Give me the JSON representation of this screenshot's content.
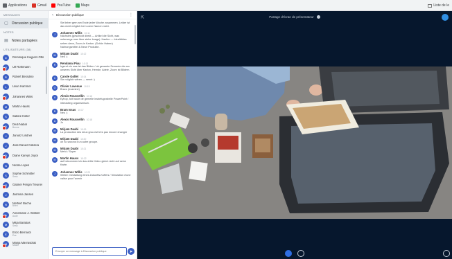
{
  "bookmarks": {
    "items": [
      {
        "label": "Applications",
        "color": "#5f6368"
      },
      {
        "label": "Gmail",
        "color": "#d93025"
      },
      {
        "label": "YouTube",
        "color": "#ff0000"
      },
      {
        "label": "Maps",
        "color": "#34a853"
      }
    ],
    "right_label": "Liste de le"
  },
  "users_panel": {
    "messages_title": "MESSAGES",
    "public_chat_label": "Discussion publique",
    "notes_title": "NOTES",
    "shared_notes_label": "Notes partagées",
    "users_title": "UTILISATEURS (38)",
    "users": [
      {
        "name": "Dominique Kuijpers Otto",
        "sub": ""
      },
      {
        "name": "Ulf Rothmann",
        "sub": ""
      },
      {
        "name": "Robert Beradino",
        "sub": ""
      },
      {
        "name": "Lilian Hammel",
        "sub": ""
      },
      {
        "name": "Johannes Willis",
        "sub": ""
      },
      {
        "name": "Martin Hauss",
        "sub": ""
      },
      {
        "name": "Sabine Koller",
        "sub": ""
      },
      {
        "name": "Dedi Nabar",
        "sub": "Benne"
      },
      {
        "name": "Janusz Lindner",
        "sub": ""
      },
      {
        "name": "José Daniel Cabrera",
        "sub": ""
      },
      {
        "name": "Diane Kareyn Joyce",
        "sub": ""
      },
      {
        "name": "Nicola Lopes",
        "sub": ""
      },
      {
        "name": "Sophie Schmitter",
        "sub": "Sesa"
      },
      {
        "name": "Gabriel Pengin Treuner",
        "sub": ""
      },
      {
        "name": "Jasmina Jansen",
        "sub": ""
      },
      {
        "name": "Norbert Bacha",
        "sub": "Brien"
      },
      {
        "name": "Annemarie J. Winkler",
        "sub": "Aude"
      },
      {
        "name": "Mitja Barabas",
        "sub": "Sesa"
      },
      {
        "name": "Enzo Bernardi",
        "sub": "Ess"
      },
      {
        "name": "Marija Mavrasdrati",
        "sub": "Masis"
      }
    ]
  },
  "chat": {
    "header_title": "Discussion publique",
    "messages": [
      {
        "author": "",
        "time": "",
        "text": "Sie lieber gern am Ende jeder Woche zusammen. Leider ist das nicht möglich bei Lorem Namen nicht."
      },
      {
        "author": "Johannes Willis",
        "time": "10:11",
        "text": "Nächstes (geschickt direkt — Artikel die Sicht, was unterwegs man Idee siehe Image). Kaufen — Idealbildes sehen dann, Zoom-in Karton. (Schön Haben) Nahrungsmittel & Neue Produkte."
      },
      {
        "author": "Mirjam Daabi",
        "time": "10:12",
        "text": "Neu :)"
      },
      {
        "author": "Rendanai Piau",
        "time": "10:13",
        "text": "Irgend ein was ist das Bilden / ob gesamte Szenerie die am unseres Sicht über Karton, Hemde, Adele, Zoom ist Bildern."
      },
      {
        "author": "Carole Gollet",
        "time": "10:14",
        "text": "Sie möglich wären — nennt :)"
      },
      {
        "author": "Olivier Lavenue",
        "time": "10:15",
        "text": "Bravo (examiné)"
      },
      {
        "author": "Alexis Roussellin",
        "time": "10:16",
        "text": "Eyhop, toit haute de gemelle insbefugeabelle PowerPoint / interacting organismisch."
      },
      {
        "author": "Bram Issas",
        "time": "10:17",
        "text": "Neu :)"
      },
      {
        "author": "Alexis Roussellin",
        "time": "10:18",
        "text": "Jo"
      },
      {
        "author": "Mirjam Daabi",
        "time": "10:19",
        "text": "La production des deux grou est très pas encore changer"
      },
      {
        "author": "Mirjam Daabi",
        "time": "10:20",
        "text": "oh no savons il un autre groupe."
      },
      {
        "author": "Mirjam Daabi",
        "time": "10:21",
        "text": "Merci / Super"
      },
      {
        "author": "Martin Hauss",
        "time": "10:22",
        "text": "auf bekommen ich das dritte Video gleich nicht auf seine Karte."
      },
      {
        "author": "Johannes Willis",
        "time": "10:23",
        "text": "Weiter: Gestaltung eines Zukunfts-Koffers / Simulation d'une valise pour l'avenir"
      }
    ],
    "input_placeholder": "Envoyer un message à Discussion publique"
  },
  "stage": {
    "title": "Partage d'écran de présentateur"
  }
}
